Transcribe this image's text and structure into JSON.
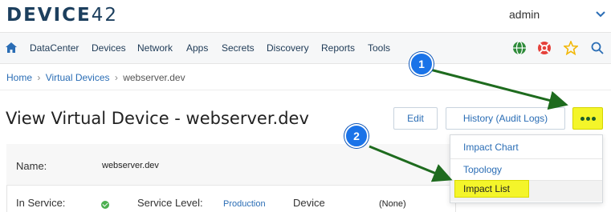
{
  "app": {
    "logo_text": "DEVICE",
    "logo_num": "42"
  },
  "user": {
    "name": "admin"
  },
  "nav": {
    "items": [
      "DataCenter",
      "Devices",
      "Network",
      "Apps",
      "Secrets",
      "Discovery",
      "Reports",
      "Tools"
    ]
  },
  "breadcrumb": {
    "home": "Home",
    "parent": "Virtual Devices",
    "sep": "›",
    "current": "webserver.dev"
  },
  "page": {
    "title": "View Virtual Device - webserver.dev"
  },
  "actions": {
    "edit": "Edit",
    "history": "History (Audit Logs)"
  },
  "details": {
    "name_label": "Name:",
    "name_value": "webserver.dev",
    "in_service_label": "In Service:",
    "service_level_label": "Service Level:",
    "service_level_value": "Production",
    "device_label": "Device",
    "device_value": "(None)"
  },
  "dropdown": {
    "items": [
      "Impact Chart",
      "Topology",
      "Impact List"
    ]
  },
  "annotations": {
    "step1": "1",
    "step2": "2"
  },
  "colors": {
    "accent": "#2a6db5",
    "highlight": "#f4f52a",
    "arrow": "#1e6b1e",
    "badge": "#1a73e8"
  },
  "icons": [
    "home-icon",
    "globe-icon",
    "lifebuoy-icon",
    "star-icon",
    "search-icon",
    "chevron-down-icon",
    "check-circle-icon",
    "more-dots-icon"
  ]
}
